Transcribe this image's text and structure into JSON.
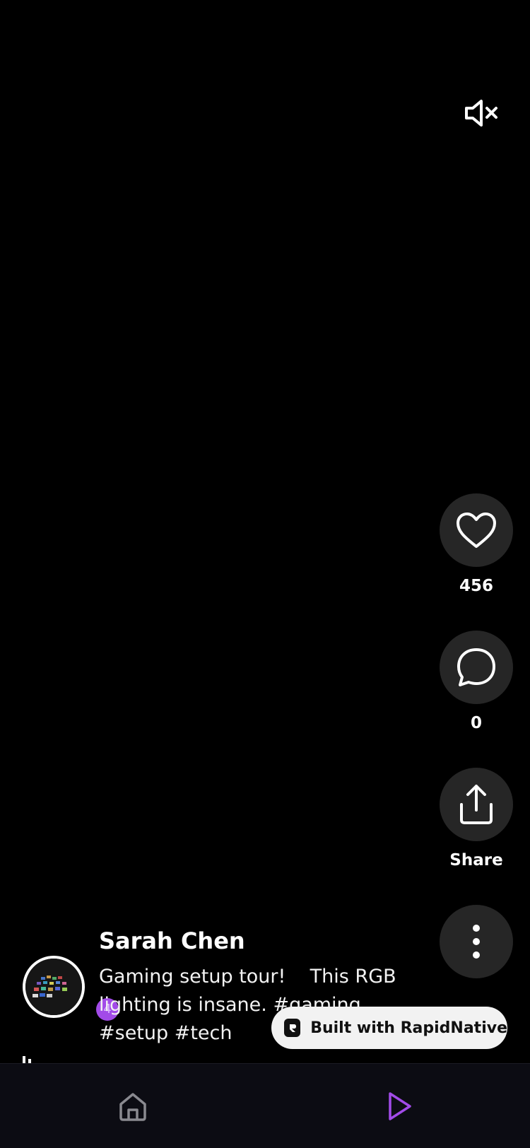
{
  "mute_button": {
    "icon": "volume-mute-icon"
  },
  "actions": {
    "like": {
      "icon": "heart-icon",
      "count": "456"
    },
    "comment": {
      "icon": "comment-icon",
      "count": "0"
    },
    "share": {
      "icon": "share-icon",
      "label": "Share"
    },
    "more": {
      "icon": "more-vertical-icon"
    }
  },
  "post": {
    "username": "Sarah Chen",
    "caption_line1": "Gaming setup tour!    This RGB",
    "caption_line2": "lighting is insane. #gaming",
    "caption_line3": "#setup #tech",
    "badge": "4"
  },
  "branding": {
    "label": "Built with RapidNative"
  },
  "nav": {
    "home": {
      "icon": "home-icon"
    },
    "play": {
      "icon": "play-icon",
      "active_color": "#a24be8"
    }
  },
  "colors": {
    "background": "#000000",
    "action_circle": "#262626",
    "accent": "#a24be8",
    "nav_bg": "#0c0c13"
  }
}
